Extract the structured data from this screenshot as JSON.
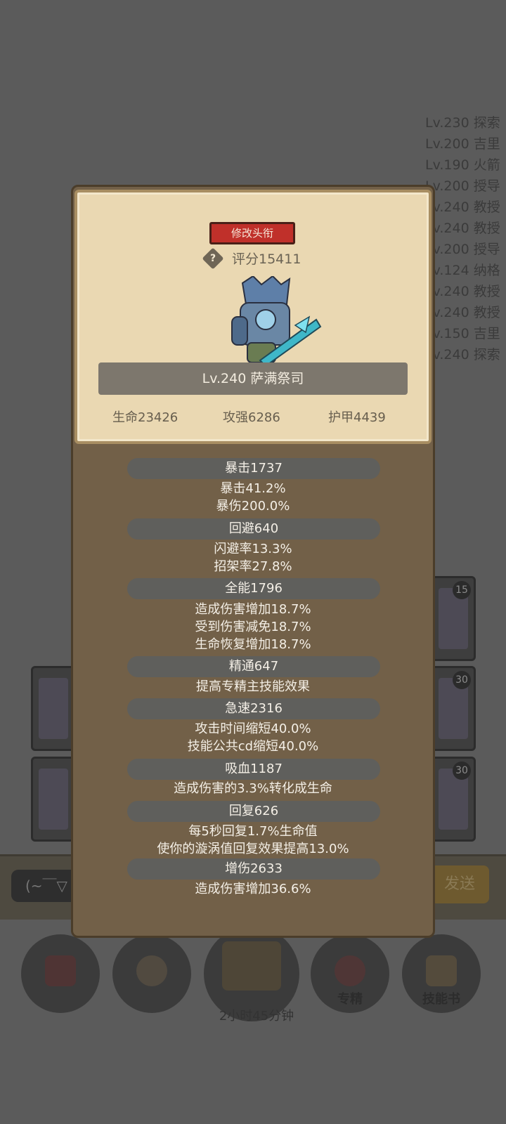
{
  "background": {
    "list": [
      "Lv.230 探索",
      "Lv.200 吉里",
      "Lv.190 火箭",
      "Lv.200 授导",
      "Lv.240 教授",
      "Lv.240 教授",
      "Lv.200 授导",
      "Lv.124 纳格",
      "Lv.240 教授",
      "Lv.240 教授",
      "Lv.150 吉里",
      "Lv.240 探索"
    ],
    "badges": [
      "15",
      "30",
      "30"
    ],
    "chat_placeholder": "(~￣▽",
    "send_label": "发送",
    "nav": [
      {
        "label": ""
      },
      {
        "label": ""
      },
      {
        "label": ""
      },
      {
        "label": "专精"
      },
      {
        "label": "技能书"
      }
    ],
    "timer": "2小时45分钟"
  },
  "card": {
    "edit_title_button": "修改头衔",
    "help_glyph": "?",
    "score": "评分15411",
    "name": "Lv.240 萨满祭司",
    "life": "生命23426",
    "attack": "攻强6286",
    "armor": "护甲4439"
  },
  "sections": [
    {
      "head": "暴击1737",
      "lines": [
        "暴击41.2%",
        "暴伤200.0%"
      ]
    },
    {
      "head": "回避640",
      "lines": [
        "闪避率13.3%",
        "招架率27.8%"
      ]
    },
    {
      "head": "全能1796",
      "lines": [
        "造成伤害增加18.7%",
        "受到伤害减免18.7%",
        "生命恢复增加18.7%"
      ]
    },
    {
      "head": "精通647",
      "lines": [
        "提高专精主技能效果"
      ]
    },
    {
      "head": "急速2316",
      "lines": [
        "攻击时间缩短40.0%",
        "技能公共cd缩短40.0%"
      ]
    },
    {
      "head": "吸血1187",
      "lines": [
        "造成伤害的3.3%转化成生命"
      ]
    },
    {
      "head": "回复626",
      "lines": [
        "每5秒回复1.7%生命值",
        "使你的漩涡值回复效果提高13.0%"
      ]
    },
    {
      "head": "增伤2633",
      "lines": [
        "造成伤害增加36.6%"
      ]
    }
  ]
}
